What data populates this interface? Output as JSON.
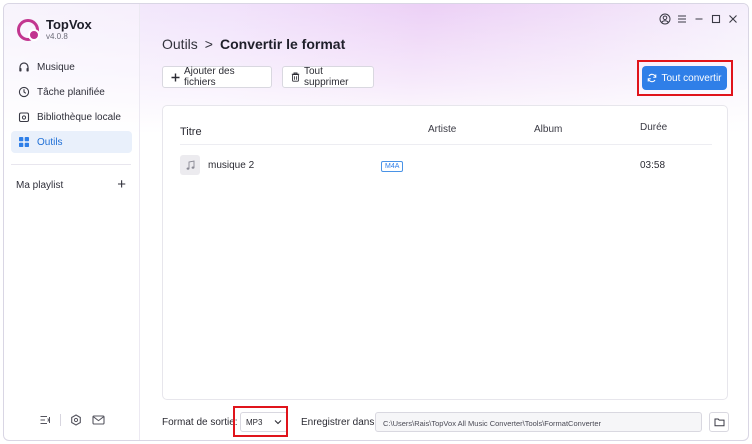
{
  "app": {
    "name": "TopVox",
    "version": "v4.0.8"
  },
  "sidebar": {
    "items": [
      {
        "label": "Musique",
        "icon": "headphones-icon"
      },
      {
        "label": "Tâche planifiée",
        "icon": "clock-icon"
      },
      {
        "label": "Bibliothèque locale",
        "icon": "library-icon"
      },
      {
        "label": "Outils",
        "icon": "grid-icon"
      }
    ],
    "active_item": "Outils",
    "playlist_label": "Ma playlist",
    "bottom_icons": [
      "collapse-icon",
      "settings-hex-icon",
      "mail-icon"
    ]
  },
  "breadcrumb": {
    "parent": "Outils",
    "separator": ">",
    "current": "Convertir le format"
  },
  "toolbar": {
    "add_label": "Ajouter des fichiers",
    "delete_label": "Tout supprimer",
    "convert_label": "Tout convertir"
  },
  "table": {
    "headers": {
      "title": "Titre",
      "artist": "Artiste",
      "album": "Album",
      "duration": "Durée"
    },
    "rows": [
      {
        "title": "musique 2",
        "format": "M4A",
        "artist": "",
        "album": "",
        "duration": "03:58"
      }
    ]
  },
  "footer": {
    "format_label": "Format de sortie:",
    "format_value": "MP3",
    "save_label": "Enregistrer dans:",
    "save_path": "C:\\Users\\Rais\\TopVox All Music Converter\\Tools\\FormatConverter"
  },
  "colors": {
    "accent": "#2f7fe8",
    "highlight": "#e0141b",
    "brand": "#c2368f"
  }
}
